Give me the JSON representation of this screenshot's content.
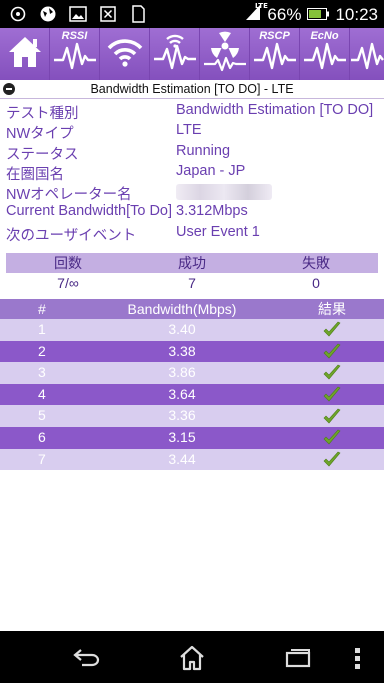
{
  "status_bar": {
    "network_type": "LTE",
    "battery_percent": "66%",
    "time": "10:23"
  },
  "toolbar": {
    "items": [
      {
        "label": "",
        "icon": "home-icon"
      },
      {
        "label": "RSSI",
        "icon": "rssi-wave-icon"
      },
      {
        "label": "",
        "icon": "wifi-icon"
      },
      {
        "label": "",
        "icon": "wifi-wave-icon"
      },
      {
        "label": "",
        "icon": "radiation-icon"
      },
      {
        "label": "RSCP",
        "icon": "rscp-wave-icon"
      },
      {
        "label": "EcNo",
        "icon": "ecno-wave-icon"
      },
      {
        "label": "",
        "icon": "more-wave-icon"
      }
    ]
  },
  "title": "Bandwidth Estimation [TO DO] - LTE",
  "info": [
    {
      "key": "テスト種別",
      "value": "Bandwidth Estimation [TO DO]"
    },
    {
      "key": "NWタイプ",
      "value": "LTE"
    },
    {
      "key": "ステータス",
      "value": "Running"
    },
    {
      "key": "在圏国名",
      "value": "Japan - JP"
    },
    {
      "key": "NWオペレーター名",
      "value": ""
    },
    {
      "key": "Current Bandwidth[To Do]",
      "value": "3.312Mbps"
    },
    {
      "key": "次のユーザイベント",
      "value": "User Event 1"
    }
  ],
  "summary": {
    "headers": [
      "回数",
      "成功",
      "失敗"
    ],
    "values": [
      "7/∞",
      "7",
      "0"
    ]
  },
  "results": {
    "headers": [
      "#",
      "Bandwidth(Mbps)",
      "結果"
    ],
    "rows": [
      {
        "num": "1",
        "bandwidth": "3.40"
      },
      {
        "num": "2",
        "bandwidth": "3.38"
      },
      {
        "num": "3",
        "bandwidth": "3.86"
      },
      {
        "num": "4",
        "bandwidth": "3.64"
      },
      {
        "num": "5",
        "bandwidth": "3.36"
      },
      {
        "num": "6",
        "bandwidth": "3.15"
      },
      {
        "num": "7",
        "bandwidth": "3.44"
      }
    ]
  },
  "colors": {
    "accent": "#8450bd",
    "text_purple": "#6a3fb0",
    "check_green": "#6fa52a"
  }
}
